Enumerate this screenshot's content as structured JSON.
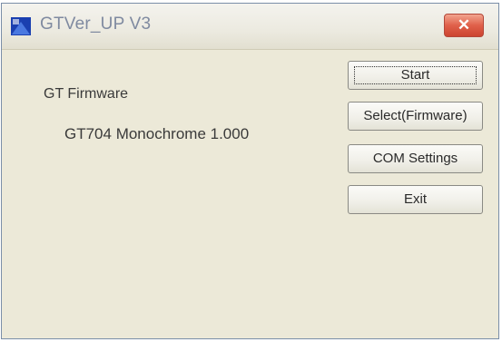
{
  "window": {
    "title": "GTVer_UP V3",
    "close_glyph": "✕"
  },
  "content": {
    "firmware_label": "GT Firmware",
    "firmware_version": "GT704 Monochrome 1.000"
  },
  "buttons": {
    "start": "Start",
    "select_firmware": "Select(Firmware)",
    "com_settings": "COM Settings",
    "exit": "Exit"
  },
  "icons": {
    "app": "app-icon",
    "close": "close-icon"
  },
  "colors": {
    "title_text": "#7f8aa0",
    "close_button": "#e0604a",
    "dialog_background": "#ece9d8"
  }
}
